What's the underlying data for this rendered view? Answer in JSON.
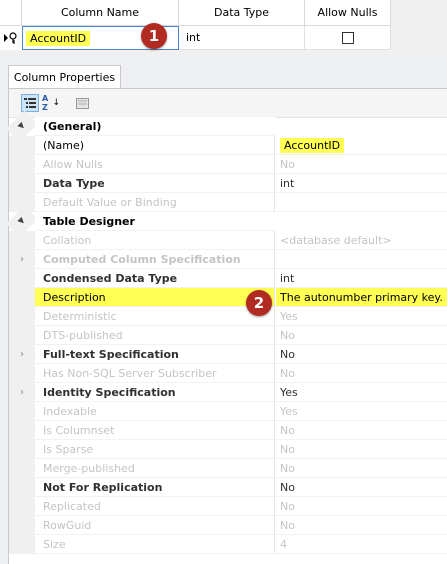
{
  "grid": {
    "headers": [
      "Column Name",
      "Data Type",
      "Allow Nulls"
    ],
    "row": {
      "column_name": "AccountID",
      "data_type": "int",
      "allow_nulls": false
    }
  },
  "badges": {
    "one": "1",
    "two": "2"
  },
  "panel": {
    "tab": "Column Properties",
    "toolbar": {
      "sort_az": "A Z"
    },
    "rows": [
      {
        "kind": "cat",
        "expander": "▲",
        "label": "(General)"
      },
      {
        "kind": "prop",
        "label": "(Name)",
        "value": "AccountID",
        "style": "normal",
        "highlight_value": true
      },
      {
        "kind": "prop",
        "label": "Allow Nulls",
        "value": "No",
        "style": "dim"
      },
      {
        "kind": "prop",
        "label": "Data Type",
        "value": "int",
        "style": "bold"
      },
      {
        "kind": "prop",
        "label": "Default Value or Binding",
        "value": "",
        "style": "dim"
      },
      {
        "kind": "cat",
        "expander": "▲",
        "label": "Table Designer"
      },
      {
        "kind": "prop",
        "label": "Collation",
        "value": "<database default>",
        "style": "dim"
      },
      {
        "kind": "prop",
        "expander": "›",
        "label": "Computed Column Specification",
        "value": "",
        "style": "dimbold"
      },
      {
        "kind": "prop",
        "label": "Condensed Data Type",
        "value": "int",
        "style": "bold"
      },
      {
        "kind": "prop",
        "label": "Description",
        "value": "The autonumber primary key.",
        "style": "desc"
      },
      {
        "kind": "prop",
        "label": "Deterministic",
        "value": "Yes",
        "style": "dim"
      },
      {
        "kind": "prop",
        "label": "DTS-published",
        "value": "No",
        "style": "dim"
      },
      {
        "kind": "prop",
        "expander": "›",
        "label": "Full-text Specification",
        "value": "No",
        "style": "bold"
      },
      {
        "kind": "prop",
        "label": "Has Non-SQL Server Subscriber",
        "value": "No",
        "style": "dim"
      },
      {
        "kind": "prop",
        "expander": "›",
        "label": "Identity Specification",
        "value": "Yes",
        "style": "bold"
      },
      {
        "kind": "prop",
        "label": "Indexable",
        "value": "Yes",
        "style": "dim"
      },
      {
        "kind": "prop",
        "label": "Is Columnset",
        "value": "No",
        "style": "dim"
      },
      {
        "kind": "prop",
        "label": "Is Sparse",
        "value": "No",
        "style": "dim"
      },
      {
        "kind": "prop",
        "label": "Merge-published",
        "value": "No",
        "style": "dim"
      },
      {
        "kind": "prop",
        "label": "Not For Replication",
        "value": "No",
        "style": "bold"
      },
      {
        "kind": "prop",
        "label": "Replicated",
        "value": "No",
        "style": "dim"
      },
      {
        "kind": "prop",
        "label": "RowGuid",
        "value": "No",
        "style": "dim"
      },
      {
        "kind": "prop",
        "label": "Size",
        "value": "4",
        "style": "dim"
      }
    ]
  }
}
